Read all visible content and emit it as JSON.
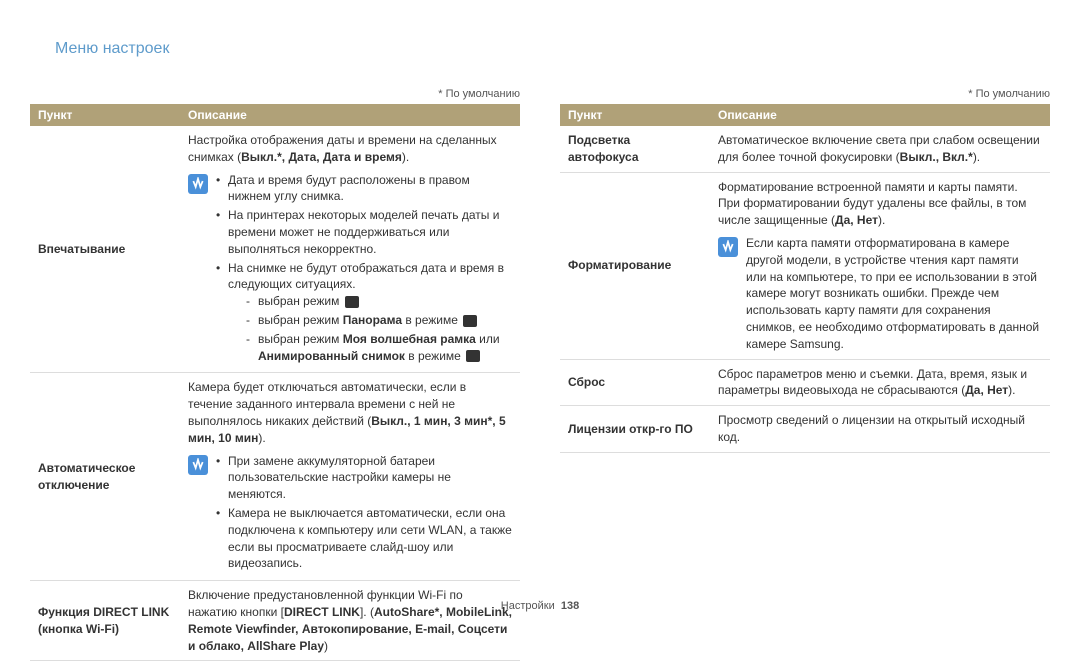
{
  "page_title": "Меню настроек",
  "default_note": "* По умолчанию",
  "headers": {
    "item": "Пункт",
    "desc": "Описание"
  },
  "left_rows": {
    "r1": {
      "key": "Впечатывание",
      "desc_line1": "Настройка отображения даты и времени на сделанных снимках (",
      "desc_opts": "Выкл.*, Дата, Дата и время",
      "desc_line1_end": ").",
      "b1": "Дата и время будут расположены в правом нижнем углу снимка.",
      "b2": "На принтерах некоторых моделей печать даты и времени может не поддерживаться или выполняться некорректно.",
      "b3": "На снимке не будут отображаться дата и время в следующих ситуациях.",
      "d1": "выбран режим ",
      "d2a": "выбран режим ",
      "d2b": "Панорама",
      "d2c": " в режиме ",
      "d3a": "выбран режим ",
      "d3b": "Моя волшебная рамка",
      "d3c": " или ",
      "d3d": "Анимированный снимок",
      "d3e": " в режиме "
    },
    "r2": {
      "key": "Автоматическое отключение",
      "desc1": "Камера будет отключаться автоматически, если в течение заданного интервала времени с ней не выполнялось никаких действий (",
      "opts": "Выкл., 1 мин, 3 мин*, 5 мин, 10 мин",
      "desc1_end": ").",
      "b1": "При замене аккумуляторной батареи пользовательские настройки камеры не меняются.",
      "b2": "Камера не выключается автоматически, если она подключена к компьютеру или сети WLAN, а также если вы просматриваете слайд-шоу или видеозапись."
    },
    "r3": {
      "key": "Функция DIRECT LINK (кнопка Wi-Fi)",
      "t1": "Включение предустановленной функции Wi-Fi по нажатию кнопки [",
      "t2": "DIRECT LINK",
      "t3": "]. (",
      "t4": "AutoShare*, MobileLink, Remote Viewfinder, Автокопирование, E-mail, Соцсети и облако, AllShare Play",
      "t5": ")"
    }
  },
  "right_rows": {
    "r1": {
      "key": "Подсветка автофокуса",
      "t1": "Автоматическое включение света при слабом освещении для более точной фокусировки (",
      "opts": "Выкл., Вкл.*",
      "t2": ")."
    },
    "r2": {
      "key": "Форматирование",
      "t1": "Форматирование встроенной памяти и карты памяти. При форматировании будут удалены все файлы, в том числе защищенные (",
      "opts": "Да, Нет",
      "t2": ").",
      "note": "Если карта памяти отформатирована в камере другой модели, в устройстве чтения карт памяти или на компьютере, то при ее использовании в этой камере могут возникать ошибки. Прежде чем использовать карту памяти для сохранения снимков, ее необходимо отформатировать в данной камере Samsung."
    },
    "r3": {
      "key": "Сброс",
      "t1": "Сброс параметров меню и съемки. Дата, время, язык и параметры видеовыхода не сбрасываются (",
      "opts": "Да, Нет",
      "t2": ")."
    },
    "r4": {
      "key": "Лицензии откр-го ПО",
      "t1": "Просмотр сведений о лицензии на открытый исходный код."
    }
  },
  "footer": {
    "label": "Настройки",
    "page": "138"
  }
}
